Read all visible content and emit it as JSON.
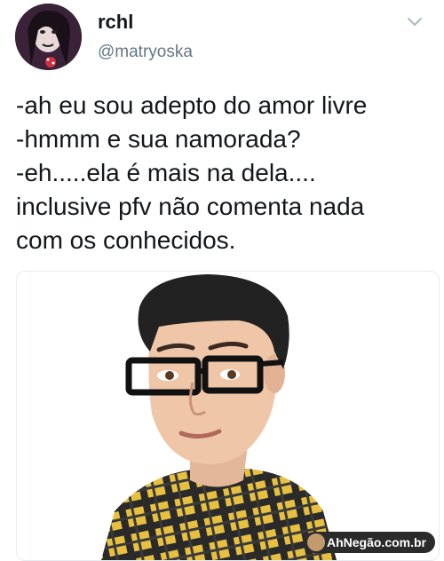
{
  "tweet": {
    "author": {
      "display_name": "rchl",
      "handle": "@matryoska"
    },
    "menu_icon": "chevron-down-icon",
    "text_lines": [
      "-ah eu sou adepto do amor livre",
      "-hmmm e sua namorada?",
      "-eh.....ela é mais na dela....",
      "inclusive pfv não comenta nada",
      "com os conhecidos."
    ],
    "media": {
      "image": "doll-with-glasses-plaid-shirt",
      "watermark": "AhNegão.com.br"
    }
  },
  "colors": {
    "text": "#14171a",
    "secondary_text": "#657786",
    "border": "#e6ecf0",
    "shirt_yellow": "#e8c040",
    "hair": "#222222"
  }
}
